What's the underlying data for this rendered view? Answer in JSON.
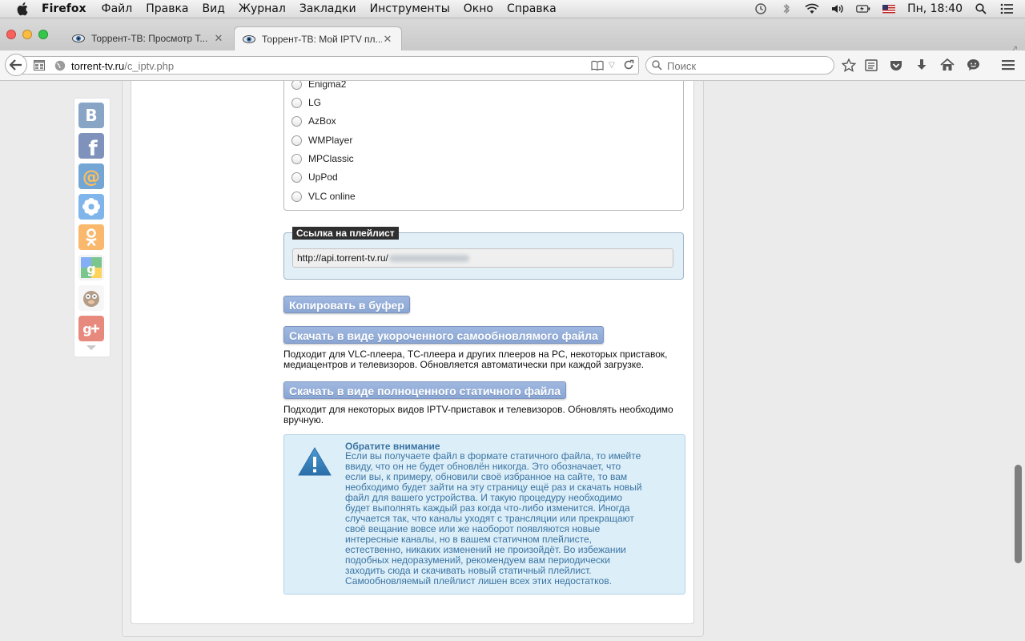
{
  "menubar": {
    "app_name": "Firefox",
    "menus": [
      "Файл",
      "Правка",
      "Вид",
      "Журнал",
      "Закладки",
      "Инструменты",
      "Окно",
      "Справка"
    ],
    "clock": "Пн, 18:40"
  },
  "tabs": [
    {
      "title": "Торрент-ТВ: Просмотр Т...",
      "active": false
    },
    {
      "title": "Торрент-ТВ: Мой IPTV пл...",
      "active": true
    }
  ],
  "navbar": {
    "url_domain": "torrent-tv.ru",
    "url_path": "/c_iptv.php",
    "search_placeholder": "Поиск"
  },
  "player_options": [
    "Enigma2",
    "LG",
    "AzBox",
    "WMPlayer",
    "MPClassic",
    "UpPod",
    "VLC online"
  ],
  "playlist_link": {
    "legend": "Ссылка на плейлист",
    "value": "http://api.torrent-tv.ru/"
  },
  "buttons": {
    "copy": "Копировать в буфер",
    "download_short": "Скачать в виде укороченного самообновлямого файла",
    "download_full": "Скачать в виде полноценного статичного файла"
  },
  "descriptions": {
    "short": "Подходит для VLC-плеера, ТС-плеера и других плееров на PC, некоторых приставок, медиацентров и телевизоров. Обновляется автоматически при каждой загрузке.",
    "full": "Подходит для некоторых видов IPTV-приставок и телевизоров. Обновлять необходимо вручную."
  },
  "notice": {
    "title": "Обратите внимание",
    "body": "Если вы получаете файл в формате статичного файла, то имейте\nввиду, что он не будет обновлён никогда. Это обозначает, что\nесли вы, к примеру, обновили своё избранное на сайте, то вам\nнеобходимо будет зайти на эту страницу ещё раз и скачать новый\nфайл для вашего устройства. И такую процедуру необходимо\nбудет выполнять каждый раз когда что-либо изменится. Иногда\nслучается так, что каналы уходят с трансляции или прекращают\nсвоё вещание вовсе или же наоборот появляются новые\nинтересные каналы, но в вашем статичном плейлисте,\nестественно, никаких изменений не произойдёт. Во избежании\nподобных недоразумений, рекомендуем вам периодически\nзаходить сюда и скачивать новый статичный плейлист.\nСамообновляемый плейлист лишен всех этих недостатков."
  },
  "social_icons": [
    "vk-icon",
    "facebook-icon",
    "mailru-icon",
    "liveinternet-icon",
    "odnoklassniki-icon",
    "google-bookmarks-icon",
    "blogger-icon",
    "google-plus-icon"
  ],
  "colors": {
    "button": "#8ea9d6",
    "notice_bg": "#dceef7",
    "notice_text": "#3a74a4",
    "link_box_bg": "#e3eff7"
  }
}
